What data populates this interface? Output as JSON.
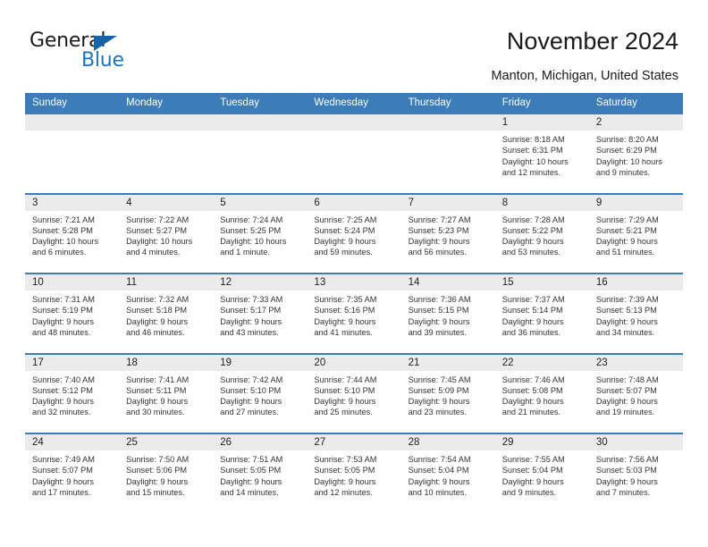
{
  "logo": {
    "word1": "General",
    "word2": "Blue",
    "triangle_color": "#1565a8",
    "blue_color": "#1b74bd"
  },
  "header": {
    "title": "November 2024",
    "subtitle": "Manton, Michigan, United States"
  },
  "theme": {
    "header_blue": "#3b7cb9",
    "daynum_band": "#ebebeb"
  },
  "calendar": {
    "weekdays": [
      "Sunday",
      "Monday",
      "Tuesday",
      "Wednesday",
      "Thursday",
      "Friday",
      "Saturday"
    ],
    "weeks": [
      [
        {
          "day": "",
          "empty": true
        },
        {
          "day": "",
          "empty": true
        },
        {
          "day": "",
          "empty": true
        },
        {
          "day": "",
          "empty": true
        },
        {
          "day": "",
          "empty": true
        },
        {
          "day": "1",
          "sunrise": "Sunrise: 8:18 AM",
          "sunset": "Sunset: 6:31 PM",
          "daylight1": "Daylight: 10 hours",
          "daylight2": "and 12 minutes."
        },
        {
          "day": "2",
          "sunrise": "Sunrise: 8:20 AM",
          "sunset": "Sunset: 6:29 PM",
          "daylight1": "Daylight: 10 hours",
          "daylight2": "and 9 minutes."
        }
      ],
      [
        {
          "day": "3",
          "sunrise": "Sunrise: 7:21 AM",
          "sunset": "Sunset: 5:28 PM",
          "daylight1": "Daylight: 10 hours",
          "daylight2": "and 6 minutes."
        },
        {
          "day": "4",
          "sunrise": "Sunrise: 7:22 AM",
          "sunset": "Sunset: 5:27 PM",
          "daylight1": "Daylight: 10 hours",
          "daylight2": "and 4 minutes."
        },
        {
          "day": "5",
          "sunrise": "Sunrise: 7:24 AM",
          "sunset": "Sunset: 5:25 PM",
          "daylight1": "Daylight: 10 hours",
          "daylight2": "and 1 minute."
        },
        {
          "day": "6",
          "sunrise": "Sunrise: 7:25 AM",
          "sunset": "Sunset: 5:24 PM",
          "daylight1": "Daylight: 9 hours",
          "daylight2": "and 59 minutes."
        },
        {
          "day": "7",
          "sunrise": "Sunrise: 7:27 AM",
          "sunset": "Sunset: 5:23 PM",
          "daylight1": "Daylight: 9 hours",
          "daylight2": "and 56 minutes."
        },
        {
          "day": "8",
          "sunrise": "Sunrise: 7:28 AM",
          "sunset": "Sunset: 5:22 PM",
          "daylight1": "Daylight: 9 hours",
          "daylight2": "and 53 minutes."
        },
        {
          "day": "9",
          "sunrise": "Sunrise: 7:29 AM",
          "sunset": "Sunset: 5:21 PM",
          "daylight1": "Daylight: 9 hours",
          "daylight2": "and 51 minutes."
        }
      ],
      [
        {
          "day": "10",
          "sunrise": "Sunrise: 7:31 AM",
          "sunset": "Sunset: 5:19 PM",
          "daylight1": "Daylight: 9 hours",
          "daylight2": "and 48 minutes."
        },
        {
          "day": "11",
          "sunrise": "Sunrise: 7:32 AM",
          "sunset": "Sunset: 5:18 PM",
          "daylight1": "Daylight: 9 hours",
          "daylight2": "and 46 minutes."
        },
        {
          "day": "12",
          "sunrise": "Sunrise: 7:33 AM",
          "sunset": "Sunset: 5:17 PM",
          "daylight1": "Daylight: 9 hours",
          "daylight2": "and 43 minutes."
        },
        {
          "day": "13",
          "sunrise": "Sunrise: 7:35 AM",
          "sunset": "Sunset: 5:16 PM",
          "daylight1": "Daylight: 9 hours",
          "daylight2": "and 41 minutes."
        },
        {
          "day": "14",
          "sunrise": "Sunrise: 7:36 AM",
          "sunset": "Sunset: 5:15 PM",
          "daylight1": "Daylight: 9 hours",
          "daylight2": "and 39 minutes."
        },
        {
          "day": "15",
          "sunrise": "Sunrise: 7:37 AM",
          "sunset": "Sunset: 5:14 PM",
          "daylight1": "Daylight: 9 hours",
          "daylight2": "and 36 minutes."
        },
        {
          "day": "16",
          "sunrise": "Sunrise: 7:39 AM",
          "sunset": "Sunset: 5:13 PM",
          "daylight1": "Daylight: 9 hours",
          "daylight2": "and 34 minutes."
        }
      ],
      [
        {
          "day": "17",
          "sunrise": "Sunrise: 7:40 AM",
          "sunset": "Sunset: 5:12 PM",
          "daylight1": "Daylight: 9 hours",
          "daylight2": "and 32 minutes."
        },
        {
          "day": "18",
          "sunrise": "Sunrise: 7:41 AM",
          "sunset": "Sunset: 5:11 PM",
          "daylight1": "Daylight: 9 hours",
          "daylight2": "and 30 minutes."
        },
        {
          "day": "19",
          "sunrise": "Sunrise: 7:42 AM",
          "sunset": "Sunset: 5:10 PM",
          "daylight1": "Daylight: 9 hours",
          "daylight2": "and 27 minutes."
        },
        {
          "day": "20",
          "sunrise": "Sunrise: 7:44 AM",
          "sunset": "Sunset: 5:10 PM",
          "daylight1": "Daylight: 9 hours",
          "daylight2": "and 25 minutes."
        },
        {
          "day": "21",
          "sunrise": "Sunrise: 7:45 AM",
          "sunset": "Sunset: 5:09 PM",
          "daylight1": "Daylight: 9 hours",
          "daylight2": "and 23 minutes."
        },
        {
          "day": "22",
          "sunrise": "Sunrise: 7:46 AM",
          "sunset": "Sunset: 5:08 PM",
          "daylight1": "Daylight: 9 hours",
          "daylight2": "and 21 minutes."
        },
        {
          "day": "23",
          "sunrise": "Sunrise: 7:48 AM",
          "sunset": "Sunset: 5:07 PM",
          "daylight1": "Daylight: 9 hours",
          "daylight2": "and 19 minutes."
        }
      ],
      [
        {
          "day": "24",
          "sunrise": "Sunrise: 7:49 AM",
          "sunset": "Sunset: 5:07 PM",
          "daylight1": "Daylight: 9 hours",
          "daylight2": "and 17 minutes."
        },
        {
          "day": "25",
          "sunrise": "Sunrise: 7:50 AM",
          "sunset": "Sunset: 5:06 PM",
          "daylight1": "Daylight: 9 hours",
          "daylight2": "and 15 minutes."
        },
        {
          "day": "26",
          "sunrise": "Sunrise: 7:51 AM",
          "sunset": "Sunset: 5:05 PM",
          "daylight1": "Daylight: 9 hours",
          "daylight2": "and 14 minutes."
        },
        {
          "day": "27",
          "sunrise": "Sunrise: 7:53 AM",
          "sunset": "Sunset: 5:05 PM",
          "daylight1": "Daylight: 9 hours",
          "daylight2": "and 12 minutes."
        },
        {
          "day": "28",
          "sunrise": "Sunrise: 7:54 AM",
          "sunset": "Sunset: 5:04 PM",
          "daylight1": "Daylight: 9 hours",
          "daylight2": "and 10 minutes."
        },
        {
          "day": "29",
          "sunrise": "Sunrise: 7:55 AM",
          "sunset": "Sunset: 5:04 PM",
          "daylight1": "Daylight: 9 hours",
          "daylight2": "and 9 minutes."
        },
        {
          "day": "30",
          "sunrise": "Sunrise: 7:56 AM",
          "sunset": "Sunset: 5:03 PM",
          "daylight1": "Daylight: 9 hours",
          "daylight2": "and 7 minutes."
        }
      ]
    ]
  }
}
